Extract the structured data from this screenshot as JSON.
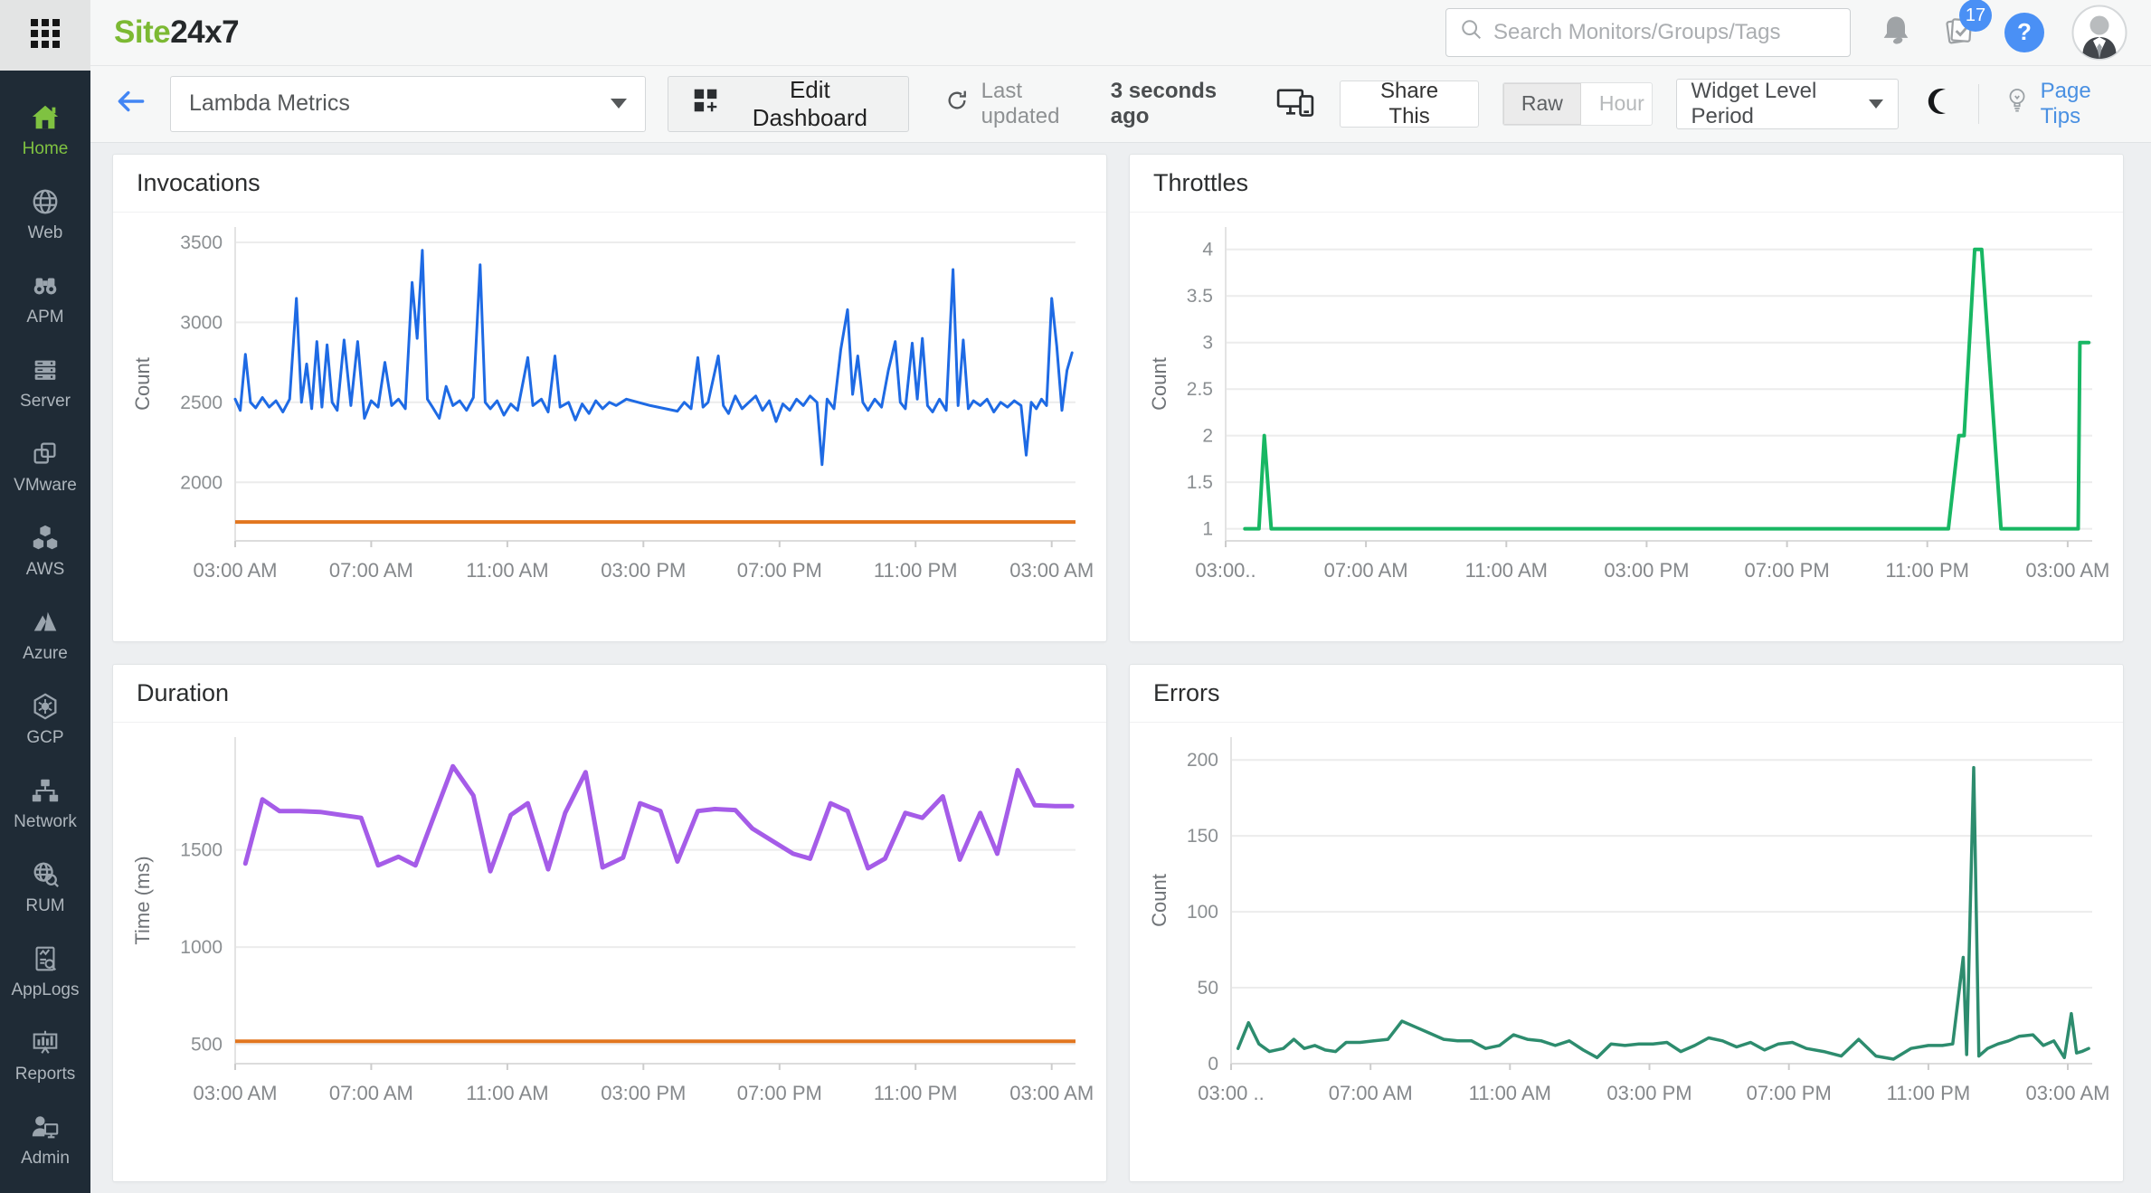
{
  "app": {
    "logo_green": "Site",
    "logo_dark": "24x7"
  },
  "topbar": {
    "search_placeholder": "Search Monitors/Groups/Tags",
    "task_badge": "17",
    "help_label": "?"
  },
  "sidebar": {
    "items": [
      {
        "label": "Home",
        "icon": "home-icon",
        "active": true
      },
      {
        "label": "Web",
        "icon": "globe-icon",
        "active": false
      },
      {
        "label": "APM",
        "icon": "binoculars-icon",
        "active": false
      },
      {
        "label": "Server",
        "icon": "server-icon",
        "active": false
      },
      {
        "label": "VMware",
        "icon": "vmware-icon",
        "active": false
      },
      {
        "label": "AWS",
        "icon": "aws-icon",
        "active": false
      },
      {
        "label": "Azure",
        "icon": "azure-icon",
        "active": false
      },
      {
        "label": "GCP",
        "icon": "gcp-icon",
        "active": false
      },
      {
        "label": "Network",
        "icon": "network-icon",
        "active": false
      },
      {
        "label": "RUM",
        "icon": "rum-icon",
        "active": false
      },
      {
        "label": "AppLogs",
        "icon": "applogs-icon",
        "active": false
      },
      {
        "label": "Reports",
        "icon": "reports-icon",
        "active": false
      },
      {
        "label": "Admin",
        "icon": "admin-icon",
        "active": false
      }
    ]
  },
  "header": {
    "dashboard_name": "Lambda Metrics",
    "edit_button": "Edit Dashboard",
    "last_updated_prefix": "Last updated",
    "last_updated_value": "3 seconds ago",
    "share_button": "Share This",
    "mode_raw": "Raw",
    "mode_hour": "Hour",
    "mode_selected": "Raw",
    "widget_period_label": "Widget Level Period",
    "page_tips": "Page Tips"
  },
  "colors": {
    "invocations_line": "#1e6ae4",
    "throttles_line": "#18b763",
    "duration_line": "#a55ce8",
    "errors_line": "#2d8c6e",
    "threshold_line": "#e2761f",
    "brand_green": "#7cb933",
    "link_blue": "#4a90e2",
    "sidebar_bg": "#1f2b36"
  },
  "chart_data": [
    {
      "type": "line",
      "title": "Invocations",
      "ylabel": "Count",
      "line_color": "#1e6ae4",
      "stroke_width": 3,
      "ylim": [
        1634,
        3596
      ],
      "yticks": [
        2000,
        2500,
        3000,
        3500
      ],
      "threshold": {
        "value": 1752,
        "color": "#e2761f"
      },
      "x_unit": "hours since 03:00 AM",
      "x_range_hours": [
        0,
        24.7
      ],
      "x_tick_hours": [
        0,
        4,
        8,
        12,
        16,
        20,
        24
      ],
      "x_tick_labels": [
        "03:00 AM",
        "07:00 AM",
        "11:00 AM",
        "03:00 PM",
        "07:00 PM",
        "11:00 PM",
        "03:00 AM"
      ],
      "points": [
        [
          0,
          2520
        ],
        [
          0.15,
          2450
        ],
        [
          0.3,
          2800
        ],
        [
          0.45,
          2500
        ],
        [
          0.6,
          2465
        ],
        [
          0.8,
          2530
        ],
        [
          1,
          2470
        ],
        [
          1.2,
          2510
        ],
        [
          1.4,
          2440
        ],
        [
          1.6,
          2520
        ],
        [
          1.8,
          3150
        ],
        [
          1.95,
          2500
        ],
        [
          2.1,
          2740
        ],
        [
          2.25,
          2460
        ],
        [
          2.4,
          2880
        ],
        [
          2.55,
          2470
        ],
        [
          2.7,
          2860
        ],
        [
          2.85,
          2500
        ],
        [
          3,
          2450
        ],
        [
          3.2,
          2890
        ],
        [
          3.4,
          2480
        ],
        [
          3.6,
          2880
        ],
        [
          3.8,
          2400
        ],
        [
          4,
          2510
        ],
        [
          4.2,
          2470
        ],
        [
          4.4,
          2750
        ],
        [
          4.6,
          2480
        ],
        [
          4.8,
          2520
        ],
        [
          5,
          2460
        ],
        [
          5.2,
          3250
        ],
        [
          5.35,
          2900
        ],
        [
          5.5,
          3450
        ],
        [
          5.65,
          2520
        ],
        [
          5.8,
          2470
        ],
        [
          6,
          2400
        ],
        [
          6.2,
          2600
        ],
        [
          6.4,
          2480
        ],
        [
          6.6,
          2510
        ],
        [
          6.8,
          2450
        ],
        [
          7,
          2530
        ],
        [
          7.2,
          3360
        ],
        [
          7.35,
          2500
        ],
        [
          7.5,
          2460
        ],
        [
          7.7,
          2510
        ],
        [
          7.9,
          2420
        ],
        [
          8.1,
          2490
        ],
        [
          8.3,
          2450
        ],
        [
          8.6,
          2780
        ],
        [
          8.75,
          2480
        ],
        [
          9,
          2520
        ],
        [
          9.2,
          2440
        ],
        [
          9.4,
          2790
        ],
        [
          9.55,
          2470
        ],
        [
          9.8,
          2500
        ],
        [
          10,
          2390
        ],
        [
          10.2,
          2490
        ],
        [
          10.4,
          2430
        ],
        [
          10.6,
          2510
        ],
        [
          10.8,
          2460
        ],
        [
          11,
          2500
        ],
        [
          11.2,
          2480
        ],
        [
          11.5,
          2520
        ],
        [
          12.2,
          2480
        ],
        [
          13,
          2445
        ],
        [
          13.2,
          2500
        ],
        [
          13.4,
          2460
        ],
        [
          13.6,
          2780
        ],
        [
          13.75,
          2470
        ],
        [
          13.9,
          2500
        ],
        [
          14.2,
          2790
        ],
        [
          14.35,
          2480
        ],
        [
          14.5,
          2430
        ],
        [
          14.7,
          2540
        ],
        [
          14.9,
          2460
        ],
        [
          15.1,
          2500
        ],
        [
          15.3,
          2540
        ],
        [
          15.5,
          2450
        ],
        [
          15.7,
          2510
        ],
        [
          15.9,
          2380
        ],
        [
          16.1,
          2490
        ],
        [
          16.3,
          2450
        ],
        [
          16.5,
          2520
        ],
        [
          16.7,
          2480
        ],
        [
          16.9,
          2540
        ],
        [
          17.1,
          2500
        ],
        [
          17.25,
          2110
        ],
        [
          17.4,
          2520
        ],
        [
          17.6,
          2460
        ],
        [
          17.8,
          2830
        ],
        [
          18,
          3080
        ],
        [
          18.15,
          2550
        ],
        [
          18.3,
          2790
        ],
        [
          18.45,
          2500
        ],
        [
          18.6,
          2450
        ],
        [
          18.8,
          2520
        ],
        [
          19,
          2470
        ],
        [
          19.2,
          2700
        ],
        [
          19.4,
          2880
        ],
        [
          19.55,
          2500
        ],
        [
          19.7,
          2460
        ],
        [
          19.9,
          2870
        ],
        [
          20.05,
          2520
        ],
        [
          20.2,
          2900
        ],
        [
          20.35,
          2480
        ],
        [
          20.5,
          2440
        ],
        [
          20.7,
          2520
        ],
        [
          20.9,
          2450
        ],
        [
          21.1,
          3330
        ],
        [
          21.25,
          2480
        ],
        [
          21.4,
          2890
        ],
        [
          21.55,
          2460
        ],
        [
          21.7,
          2510
        ],
        [
          21.9,
          2480
        ],
        [
          22.1,
          2520
        ],
        [
          22.3,
          2440
        ],
        [
          22.5,
          2500
        ],
        [
          22.7,
          2470
        ],
        [
          22.9,
          2510
        ],
        [
          23.1,
          2480
        ],
        [
          23.25,
          2170
        ],
        [
          23.4,
          2500
        ],
        [
          23.55,
          2460
        ],
        [
          23.7,
          2520
        ],
        [
          23.85,
          2480
        ],
        [
          24,
          3150
        ],
        [
          24.15,
          2850
        ],
        [
          24.3,
          2450
        ],
        [
          24.45,
          2700
        ],
        [
          24.6,
          2810
        ]
      ]
    },
    {
      "type": "line",
      "title": "Throttles",
      "ylabel": "Count",
      "line_color": "#18b763",
      "stroke_width": 4,
      "ylim": [
        0.87,
        4.24
      ],
      "yticks": [
        1,
        1.5,
        2,
        2.5,
        3,
        3.5,
        4
      ],
      "threshold": null,
      "x_unit": "hours since 03:00 AM",
      "x_range_hours": [
        0,
        24.7
      ],
      "x_tick_hours": [
        0,
        4,
        8,
        12,
        16,
        20,
        24
      ],
      "x_tick_labels": [
        "03:00..",
        "07:00 AM",
        "11:00 AM",
        "03:00 PM",
        "07:00 PM",
        "11:00 PM",
        "03:00 AM"
      ],
      "points": [
        [
          0.55,
          1
        ],
        [
          0.95,
          1
        ],
        [
          1.1,
          2
        ],
        [
          1.3,
          1
        ],
        [
          3,
          1
        ],
        [
          6,
          1
        ],
        [
          9,
          1
        ],
        [
          12,
          1
        ],
        [
          15,
          1
        ],
        [
          18,
          1
        ],
        [
          20.6,
          1
        ],
        [
          20.9,
          2
        ],
        [
          21.05,
          2
        ],
        [
          21.35,
          4
        ],
        [
          21.55,
          4
        ],
        [
          22.1,
          1
        ],
        [
          23,
          1
        ],
        [
          24.3,
          1
        ],
        [
          24.35,
          3
        ],
        [
          24.6,
          3
        ]
      ]
    },
    {
      "type": "line",
      "title": "Duration",
      "ylabel": "Time (ms)",
      "line_color": "#a55ce8",
      "stroke_width": 5,
      "ylim": [
        400,
        2080
      ],
      "yticks": [
        500,
        1000,
        1500
      ],
      "threshold": {
        "value": 515,
        "color": "#e2761f"
      },
      "x_unit": "hours since 03:00 AM",
      "x_range_hours": [
        0,
        24.7
      ],
      "x_tick_hours": [
        0,
        4,
        8,
        12,
        16,
        20,
        24
      ],
      "x_tick_labels": [
        "03:00 AM",
        "07:00 AM",
        "11:00 AM",
        "03:00 PM",
        "07:00 PM",
        "11:00 PM",
        "03:00 AM"
      ],
      "points": [
        [
          0.3,
          1430
        ],
        [
          0.8,
          1760
        ],
        [
          1.3,
          1700
        ],
        [
          1.9,
          1700
        ],
        [
          2.5,
          1695
        ],
        [
          3.1,
          1680
        ],
        [
          3.7,
          1665
        ],
        [
          4.2,
          1420
        ],
        [
          4.8,
          1465
        ],
        [
          5.3,
          1420
        ],
        [
          5.9,
          1700
        ],
        [
          6.4,
          1930
        ],
        [
          7,
          1780
        ],
        [
          7.5,
          1390
        ],
        [
          8.1,
          1680
        ],
        [
          8.6,
          1740
        ],
        [
          9.2,
          1400
        ],
        [
          9.7,
          1690
        ],
        [
          10.3,
          1900
        ],
        [
          10.8,
          1410
        ],
        [
          11.4,
          1460
        ],
        [
          11.9,
          1740
        ],
        [
          12.5,
          1700
        ],
        [
          13,
          1440
        ],
        [
          13.6,
          1700
        ],
        [
          14.1,
          1710
        ],
        [
          14.7,
          1705
        ],
        [
          15.2,
          1610
        ],
        [
          15.8,
          1545
        ],
        [
          16.4,
          1480
        ],
        [
          16.9,
          1455
        ],
        [
          17.5,
          1740
        ],
        [
          18,
          1700
        ],
        [
          18.6,
          1405
        ],
        [
          19.1,
          1455
        ],
        [
          19.7,
          1690
        ],
        [
          20.2,
          1665
        ],
        [
          20.8,
          1775
        ],
        [
          21.3,
          1450
        ],
        [
          21.9,
          1690
        ],
        [
          22.4,
          1480
        ],
        [
          23,
          1910
        ],
        [
          23.5,
          1730
        ],
        [
          24.1,
          1725
        ],
        [
          24.6,
          1725
        ]
      ]
    },
    {
      "type": "line",
      "title": "Errors",
      "ylabel": "Count",
      "line_color": "#2d8c6e",
      "stroke_width": 3.5,
      "ylim": [
        0,
        215
      ],
      "yticks": [
        0,
        50,
        100,
        150,
        200
      ],
      "threshold": null,
      "x_unit": "hours since 03:00 AM",
      "x_range_hours": [
        0,
        24.7
      ],
      "x_tick_hours": [
        0,
        4,
        8,
        12,
        16,
        20,
        24
      ],
      "x_tick_labels": [
        "03:00 ..",
        "07:00 AM",
        "11:00 AM",
        "03:00 PM",
        "07:00 PM",
        "11:00 PM",
        "03:00 AM"
      ],
      "points": [
        [
          0.2,
          10
        ],
        [
          0.5,
          27
        ],
        [
          0.8,
          13
        ],
        [
          1.1,
          8
        ],
        [
          1.5,
          10
        ],
        [
          1.8,
          16
        ],
        [
          2.1,
          10
        ],
        [
          2.4,
          12
        ],
        [
          2.7,
          9
        ],
        [
          3,
          8
        ],
        [
          3.3,
          14
        ],
        [
          3.7,
          14
        ],
        [
          4.1,
          15
        ],
        [
          4.5,
          16
        ],
        [
          4.9,
          28
        ],
        [
          5.3,
          24
        ],
        [
          5.7,
          20
        ],
        [
          6.1,
          16
        ],
        [
          6.5,
          15
        ],
        [
          6.9,
          15
        ],
        [
          7.3,
          10
        ],
        [
          7.7,
          12
        ],
        [
          8.1,
          19
        ],
        [
          8.5,
          16
        ],
        [
          8.9,
          15
        ],
        [
          9.3,
          12
        ],
        [
          9.7,
          15
        ],
        [
          10.1,
          9
        ],
        [
          10.5,
          4
        ],
        [
          10.9,
          13
        ],
        [
          11.3,
          12
        ],
        [
          11.7,
          13
        ],
        [
          12.1,
          13
        ],
        [
          12.5,
          14
        ],
        [
          12.9,
          8
        ],
        [
          13.3,
          12
        ],
        [
          13.7,
          17
        ],
        [
          14.1,
          15
        ],
        [
          14.5,
          11
        ],
        [
          14.9,
          14
        ],
        [
          15.3,
          9
        ],
        [
          15.7,
          13
        ],
        [
          16.1,
          14
        ],
        [
          16.5,
          10
        ],
        [
          17,
          8
        ],
        [
          17.5,
          5
        ],
        [
          18,
          16
        ],
        [
          18.5,
          5
        ],
        [
          19,
          3
        ],
        [
          19.5,
          10
        ],
        [
          20,
          12
        ],
        [
          20.4,
          12
        ],
        [
          20.7,
          13
        ],
        [
          21,
          70
        ],
        [
          21.1,
          6
        ],
        [
          21.3,
          195
        ],
        [
          21.45,
          5
        ],
        [
          21.7,
          10
        ],
        [
          22,
          13
        ],
        [
          22.3,
          15
        ],
        [
          22.6,
          18
        ],
        [
          23,
          19
        ],
        [
          23.3,
          12
        ],
        [
          23.6,
          15
        ],
        [
          23.9,
          4
        ],
        [
          24.1,
          33
        ],
        [
          24.25,
          7
        ],
        [
          24.4,
          8
        ],
        [
          24.6,
          10
        ]
      ]
    }
  ]
}
